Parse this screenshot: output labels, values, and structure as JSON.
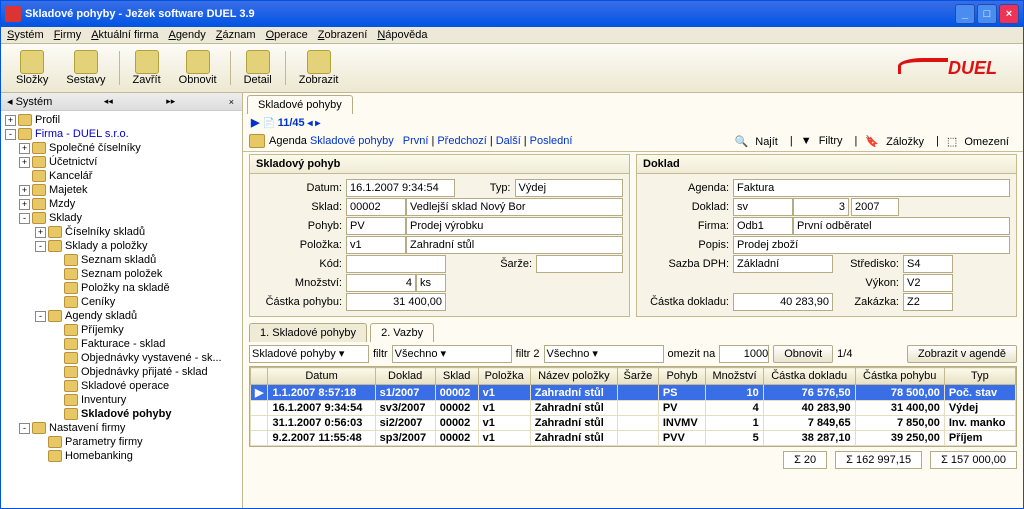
{
  "window": {
    "title": "Skladové pohyby  -  Ježek software DUEL 3.9"
  },
  "menu": [
    "Systém",
    "Firmy",
    "Aktuální firma",
    "Agendy",
    "Záznam",
    "Operace",
    "Zobrazení",
    "Nápověda"
  ],
  "toolbar": [
    "Složky",
    "Sestavy",
    "Zavřít",
    "Obnovit",
    "Detail",
    "Zobrazit"
  ],
  "sidebar": {
    "title": "Systém",
    "items": [
      {
        "lvl": 0,
        "tw": "+",
        "label": "Profil"
      },
      {
        "lvl": 0,
        "tw": "-",
        "label": "Firma - DUEL s.r.o.",
        "blue": true
      },
      {
        "lvl": 1,
        "tw": "+",
        "label": "Společné číselníky"
      },
      {
        "lvl": 1,
        "tw": "+",
        "label": "Účetnictví"
      },
      {
        "lvl": 1,
        "tw": "",
        "label": "Kancelář"
      },
      {
        "lvl": 1,
        "tw": "+",
        "label": "Majetek"
      },
      {
        "lvl": 1,
        "tw": "+",
        "label": "Mzdy"
      },
      {
        "lvl": 1,
        "tw": "-",
        "label": "Sklady"
      },
      {
        "lvl": 2,
        "tw": "+",
        "label": "Číselníky skladů"
      },
      {
        "lvl": 2,
        "tw": "-",
        "label": "Sklady a položky"
      },
      {
        "lvl": 3,
        "tw": "",
        "label": "Seznam skladů"
      },
      {
        "lvl": 3,
        "tw": "",
        "label": "Seznam položek"
      },
      {
        "lvl": 3,
        "tw": "",
        "label": "Položky na skladě"
      },
      {
        "lvl": 3,
        "tw": "",
        "label": "Ceníky"
      },
      {
        "lvl": 2,
        "tw": "-",
        "label": "Agendy skladů"
      },
      {
        "lvl": 3,
        "tw": "",
        "label": "Příjemky"
      },
      {
        "lvl": 3,
        "tw": "",
        "label": "Fakturace - sklad"
      },
      {
        "lvl": 3,
        "tw": "",
        "label": "Objednávky vystavené - sk..."
      },
      {
        "lvl": 3,
        "tw": "",
        "label": "Objednávky přijaté - sklad"
      },
      {
        "lvl": 3,
        "tw": "",
        "label": "Skladové operace"
      },
      {
        "lvl": 3,
        "tw": "",
        "label": "Inventury"
      },
      {
        "lvl": 3,
        "tw": "",
        "label": "Skladové pohyby",
        "bold": true
      },
      {
        "lvl": 1,
        "tw": "-",
        "label": "Nastavení firmy"
      },
      {
        "lvl": 2,
        "tw": "",
        "label": "Parametry firmy"
      },
      {
        "lvl": 2,
        "tw": "",
        "label": "Homebanking"
      }
    ]
  },
  "tab": "Skladové pohyby",
  "counter": "11/45",
  "nav": {
    "agenda": "Agenda",
    "link": "Skladové pohyby",
    "first": "První",
    "prev": "Předchozí",
    "next": "Další",
    "last": "Poslední",
    "find": "Najít",
    "filters": "Filtry",
    "bookmarks": "Záložky",
    "limit": "Omezení"
  },
  "panelL": {
    "title": "Skladový pohyb",
    "datum": {
      "l": "Datum:",
      "v": "16.1.2007 9:34:54"
    },
    "typ": {
      "l": "Typ:",
      "v": "Výdej"
    },
    "sklad": {
      "l": "Sklad:",
      "v1": "00002",
      "v2": "Vedlejší sklad Nový Bor"
    },
    "pohyb": {
      "l": "Pohyb:",
      "v1": "PV",
      "v2": "Prodej výrobku"
    },
    "polozka": {
      "l": "Položka:",
      "v1": "v1",
      "v2": "Zahradní stůl"
    },
    "kod": {
      "l": "Kód:",
      "v": ""
    },
    "sarze": {
      "l": "Šarže:",
      "v": ""
    },
    "mnozstvi": {
      "l": "Množství:",
      "v": "4",
      "u": "ks"
    },
    "castka": {
      "l": "Částka pohybu:",
      "v": "31 400,00"
    }
  },
  "panelR": {
    "title": "Doklad",
    "agenda": {
      "l": "Agenda:",
      "v": "Faktura"
    },
    "doklad": {
      "l": "Doklad:",
      "v1": "sv",
      "v2": "3",
      "v3": "2007"
    },
    "firma": {
      "l": "Firma:",
      "v1": "Odb1",
      "v2": "První odběratel"
    },
    "popis": {
      "l": "Popis:",
      "v": "Prodej zboží"
    },
    "sazba": {
      "l": "Sazba DPH:",
      "v": "Základní"
    },
    "stredisko": {
      "l": "Středisko:",
      "v": "S4"
    },
    "vykon": {
      "l": "Výkon:",
      "v": "V2"
    },
    "castka": {
      "l": "Částka dokladu:",
      "v": "40 283,90"
    },
    "zakazka": {
      "l": "Zakázka:",
      "v": "Z2"
    }
  },
  "subtabs": [
    "1. Skladové pohyby",
    "2. Vazby"
  ],
  "filter": {
    "dd": "Skladové pohyby",
    "f1l": "filtr",
    "f1": "Všechno",
    "f2l": "filtr 2",
    "f2": "Všechno",
    "limitl": "omezit na",
    "limit": "1000",
    "refresh": "Obnovit",
    "page": "1/4",
    "show": "Zobrazit v agendě"
  },
  "cols": [
    "Datum",
    "Doklad",
    "Sklad",
    "Položka",
    "Název položky",
    "Šarže",
    "Pohyb",
    "Množství",
    "Částka dokladu",
    "Částka pohybu",
    "Typ"
  ],
  "rows": [
    {
      "sel": true,
      "bold": true,
      "d": "1.1.2007 8:57:18",
      "dok": "s1/2007",
      "sk": "00002",
      "p": "v1",
      "np": "Zahradní stůl",
      "sa": "",
      "po": "PS",
      "m": "10",
      "cd": "76 576,50",
      "cp": "78 500,00",
      "t": "Poč. stav"
    },
    {
      "bold": true,
      "d": "16.1.2007 9:34:54",
      "dok": "sv3/2007",
      "sk": "00002",
      "p": "v1",
      "np": "Zahradní stůl",
      "sa": "",
      "po": "PV",
      "m": "4",
      "cd": "40 283,90",
      "cp": "31 400,00",
      "t": "Výdej"
    },
    {
      "bold": true,
      "d": "31.1.2007 0:56:03",
      "dok": "si2/2007",
      "sk": "00002",
      "p": "v1",
      "np": "Zahradní stůl",
      "sa": "",
      "po": "INVMV",
      "m": "1",
      "cd": "7 849,65",
      "cp": "7 850,00",
      "t": "Inv. manko"
    },
    {
      "bold": true,
      "d": "9.2.2007 11:55:48",
      "dok": "sp3/2007",
      "sk": "00002",
      "p": "v1",
      "np": "Zahradní stůl",
      "sa": "",
      "po": "PVV",
      "m": "5",
      "cd": "38 287,10",
      "cp": "39 250,00",
      "t": "Příjem"
    }
  ],
  "sums": {
    "m": "Σ 20",
    "cd": "Σ 162 997,15",
    "cp": "Σ 157 000,00"
  }
}
